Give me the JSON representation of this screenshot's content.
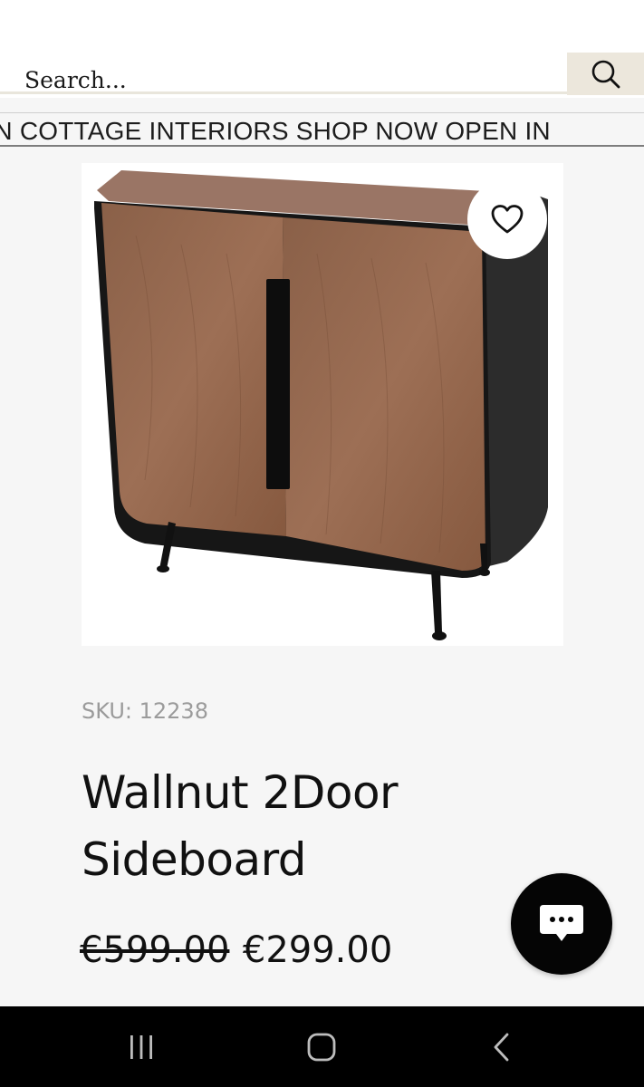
{
  "search": {
    "placeholder": "Search..."
  },
  "icons": {
    "search": "search-icon",
    "wishlist": "heart-icon",
    "chat": "chat-bubble-icon",
    "nav_recents": "recents-icon",
    "nav_home": "home-icon",
    "nav_back": "back-icon"
  },
  "marquee": {
    "text": "RN COTTAGE INTERIORS  SHOP NOW OPEN IN"
  },
  "product": {
    "sku": "SKU: 12238",
    "title": "Wallnut 2Door Sideboard",
    "old_price": "€599.00",
    "price": "€299.00",
    "image_alt": "Walnut two door sideboard with black metal frame"
  },
  "colors": {
    "accent": "#ece7dc",
    "background": "#f6f6f6",
    "text": "#111111",
    "chat_button": "#050505"
  }
}
